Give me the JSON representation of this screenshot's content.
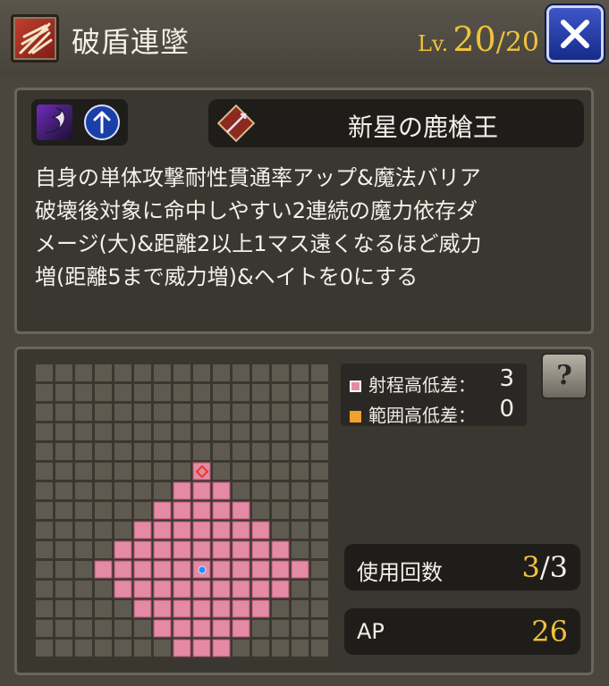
{
  "header": {
    "skill_name": "破盾連墜",
    "level_prefix": "Lv.",
    "level_current": "20",
    "level_separator": "/",
    "level_max": "20"
  },
  "description": {
    "weapon_name": "新星の鹿槍王",
    "text": "自身の単体攻撃耐性貫通率アップ&魔法バリア\n破壊後対象に命中しやすい2連続の魔力依存ダ\nメージ(大)&距離2以上1マス遠くなるほど威力\n増(距離5まで威力増)&ヘイトを0にする"
  },
  "range": {
    "grid_size": 15,
    "center": [
      8,
      10
    ],
    "max_distance": 5,
    "marker_icon": "diamond-target-icon",
    "legend": {
      "range_label": "射程高低差：",
      "range_value": "3",
      "range_color": "#e58aa5",
      "area_label": "範囲高低差：",
      "area_value": "0",
      "area_color": "#f2a12c"
    },
    "help_label": "?"
  },
  "stats": {
    "uses_label": "使用回数",
    "uses_current": "3",
    "uses_separator": "/",
    "uses_max": "3",
    "ap_label": "AP",
    "ap_value": "26"
  },
  "colors": {
    "accent_gold": "#f0c23c",
    "range_pink": "#e58aa5",
    "close_blue": "#2a44b8"
  }
}
